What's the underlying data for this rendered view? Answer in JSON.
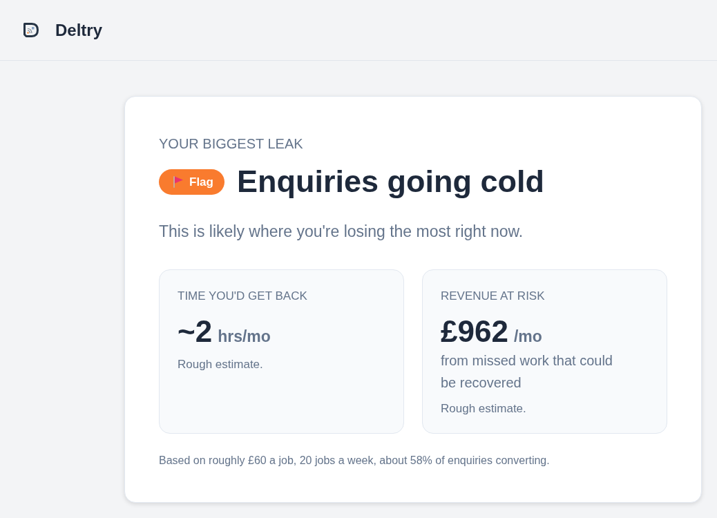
{
  "header": {
    "brand": "Deltry"
  },
  "card": {
    "eyebrow": "YOUR BIGGEST LEAK",
    "badge": {
      "label": "Flag"
    },
    "title": "Enquiries going cold",
    "subtitle": "This is likely where you're losing the most right now.",
    "stats": [
      {
        "label": "TIME YOU'D GET BACK",
        "value": "~2",
        "unit": "hrs/mo",
        "note": "Rough estimate."
      },
      {
        "label": "REVENUE AT RISK",
        "value": "£962",
        "unit": "/mo",
        "detail": "from missed work that could be recovered",
        "note": "Rough estimate."
      }
    ],
    "footnote": "Based on roughly £60 a job, 20 jobs a week, about 58% of enquiries converting."
  }
}
